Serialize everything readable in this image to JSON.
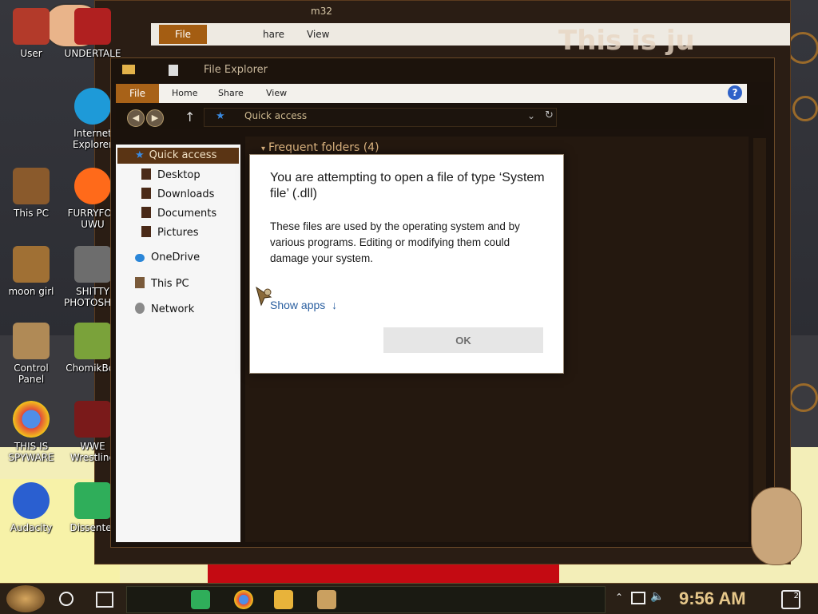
{
  "desktop": {
    "icons_left": [
      {
        "label": "User",
        "color": "#b33a2a"
      },
      {
        "label": "This PC",
        "color": "#8a5a2c"
      },
      {
        "label": "moon girl",
        "color": "#a07034"
      },
      {
        "label": "Control Panel",
        "color": "#b08a56"
      },
      {
        "label": "THIS IS SPYWARE",
        "color": "#4f8ee8"
      },
      {
        "label": "Audacity",
        "color": "#2a5fd0"
      }
    ],
    "icons_second": [
      {
        "label": "UNDERTALE",
        "color": "#b02020"
      },
      {
        "label": "Internet Explorer",
        "color": "#1e9ad8"
      },
      {
        "label": "FURRYFOX UWU",
        "color": "#ff6a1a"
      },
      {
        "label": "SHITTY PHOTOSHOP",
        "color": "#6d6d6d"
      },
      {
        "label": "ChomikBox",
        "color": "#7aa23a"
      },
      {
        "label": "WWE Wrestling",
        "color": "#7a1a1a"
      },
      {
        "label": "Dissenter",
        "color": "#2fae5a"
      }
    ],
    "watermark_text": "This is ju"
  },
  "background_window": {
    "title_fragment": "m32",
    "ribbon": {
      "file": "File",
      "share": "hare",
      "view": "View"
    }
  },
  "explorer": {
    "title": "File Explorer",
    "ribbon": {
      "file": "File",
      "home": "Home",
      "share": "Share",
      "view": "View",
      "help": "?"
    },
    "address": "Quick access",
    "nav": {
      "quick_access": "Quick access",
      "desktop": "Desktop",
      "downloads": "Downloads",
      "documents": "Documents",
      "pictures": "Pictures",
      "onedrive": "OneDrive",
      "this_pc": "This PC",
      "network": "Network"
    },
    "content": {
      "frequent_folders": "Frequent folders (4)"
    }
  },
  "dialog": {
    "title": "You are attempting to open a file of type ‘System file’ (.dll)",
    "body": "These files are used by the operating system and by various programs. Editing or modifying them could damage your system.",
    "show_apps": "Show apps",
    "ok_label": "OK"
  },
  "taskbar": {
    "time": "9:56 AM",
    "notification_count": "2"
  }
}
